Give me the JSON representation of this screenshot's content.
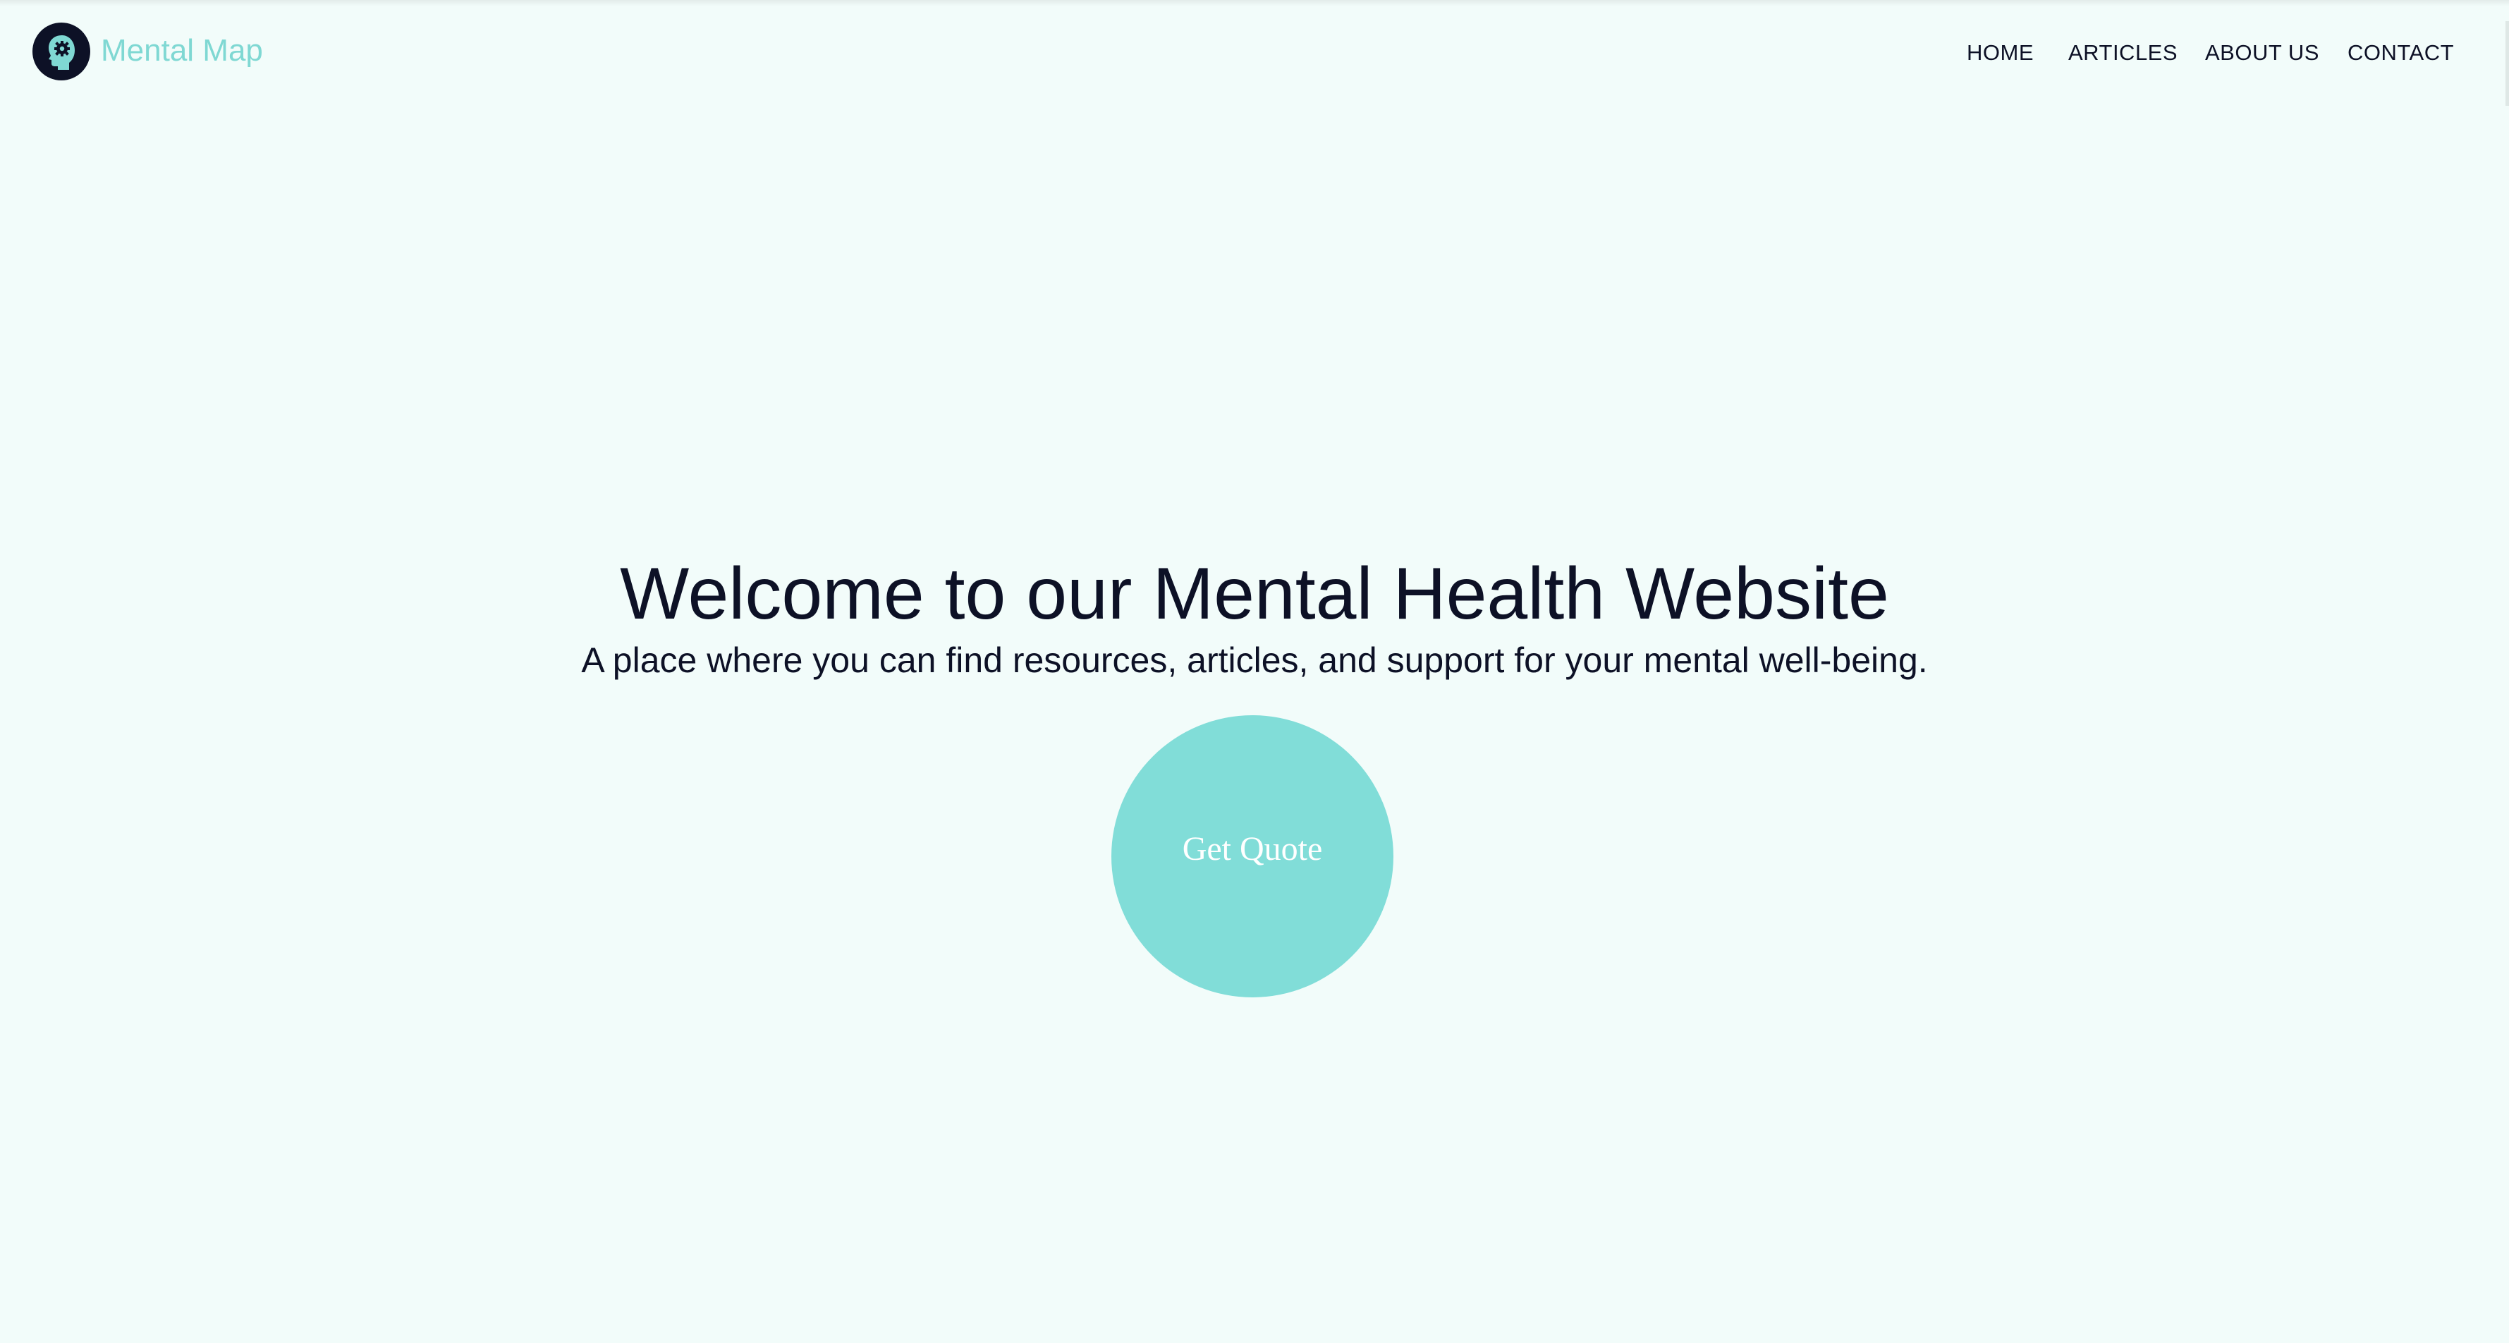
{
  "header": {
    "brand_name": "Mental Map",
    "logo_icon": "head-with-gear-icon",
    "nav": {
      "items": [
        {
          "label": "HOME"
        },
        {
          "label": "ARTICLES"
        },
        {
          "label": "ABOUT US"
        },
        {
          "label": "CONTACT"
        }
      ]
    }
  },
  "hero": {
    "title": "Welcome to our Mental Health Website",
    "subtitle": "A place where you can find resources, articles, and support for your mental well-being.",
    "cta_label": "Get Quote"
  },
  "colors": {
    "background": "#f2fcfa",
    "accent": "#81ddd8",
    "brand_text": "#7fd8d3",
    "dark": "#0d1126",
    "button_text": "#ffffff"
  }
}
